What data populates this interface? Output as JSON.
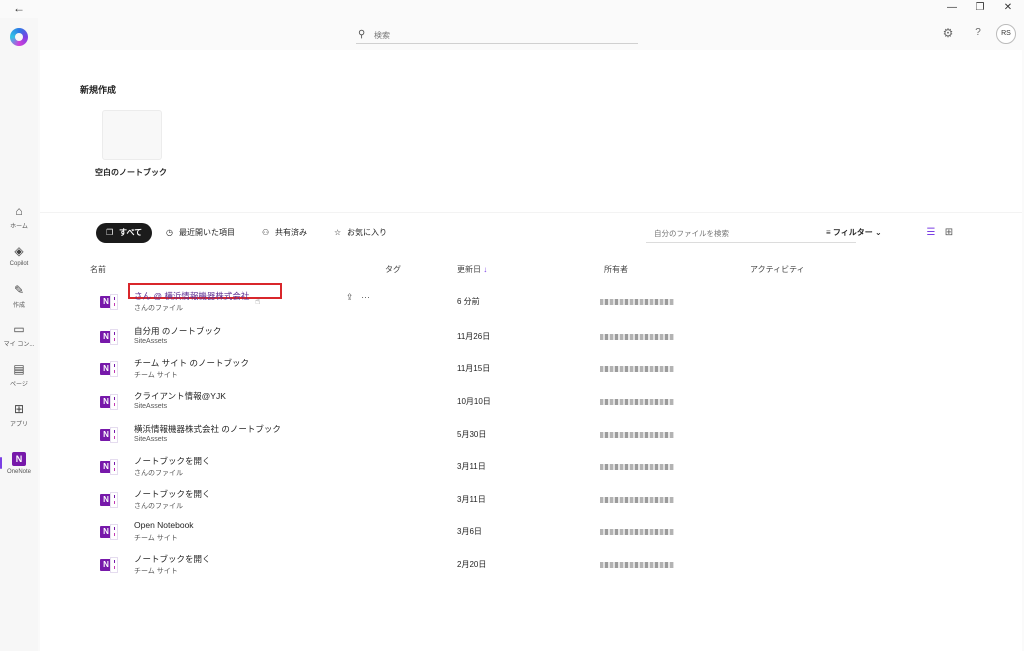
{
  "window": {
    "back_icon": "←",
    "minimize_icon": "—",
    "restore_icon": "❐",
    "close_icon": "✕"
  },
  "rail": {
    "items": [
      {
        "label": "ホーム",
        "icon": "⌂"
      },
      {
        "label": "Copilot",
        "icon": "◈"
      },
      {
        "label": "作成",
        "icon": "✎"
      },
      {
        "label": "マイ コン...",
        "icon": "▭"
      },
      {
        "label": "ページ",
        "icon": "▤"
      },
      {
        "label": "アプリ",
        "icon": "⊞"
      },
      {
        "label": "OneNote",
        "icon": "N"
      }
    ]
  },
  "topbar": {
    "search_placeholder": "検索",
    "search_icon": "⚲",
    "gear_icon": "⚙",
    "help_icon": "?",
    "avatar_initials": "RS"
  },
  "new_section": {
    "title": "新規作成",
    "blank_card_label": "空白のノートブック"
  },
  "filters": {
    "all": "すべて",
    "recent": "最近開いた項目",
    "shared": "共有済み",
    "favorites": "お気に入り",
    "file_search_placeholder": "自分のファイルを検索",
    "filter_button": "フィルター",
    "filter_chevron": "⌄",
    "list_view_icon": "☰",
    "grid_view_icon": "⊞"
  },
  "table": {
    "headers": {
      "name": "名前",
      "tag": "タグ",
      "modified": "更新日",
      "sort_icon": "↓",
      "owner": "所有者",
      "activity": "アクティビティ"
    },
    "rows": [
      {
        "title": "さん @ 横浜情報機器株式会社",
        "subtitle": "さんのファイル",
        "date": "6 分前"
      },
      {
        "title": "自分用 のノートブック",
        "subtitle": "SiteAssets",
        "date": "11月26日"
      },
      {
        "title": "チーム サイト のノートブック",
        "subtitle": "チーム サイト",
        "date": "11月15日"
      },
      {
        "title": "クライアント情報@YJK",
        "subtitle": "SiteAssets",
        "date": "10月10日"
      },
      {
        "title": "横浜情報機器株式会社 のノートブック",
        "subtitle": "SiteAssets",
        "date": "5月30日"
      },
      {
        "title": "ノートブックを開く",
        "subtitle": "さんのファイル",
        "date": "3月11日"
      },
      {
        "title": "ノートブックを開く",
        "subtitle": "さんのファイル",
        "date": "3月11日"
      },
      {
        "title": "Open Notebook",
        "subtitle": "チーム サイト",
        "date": "3月6日"
      },
      {
        "title": "ノートブックを開く",
        "subtitle": "チーム サイト",
        "date": "2月20日"
      }
    ],
    "row_actions": {
      "share_icon": "⇪",
      "more_icon": "···"
    }
  },
  "colors": {
    "accent": "#7b3fe4",
    "onenote": "#7719aa",
    "highlight_box": "#d9262b"
  }
}
